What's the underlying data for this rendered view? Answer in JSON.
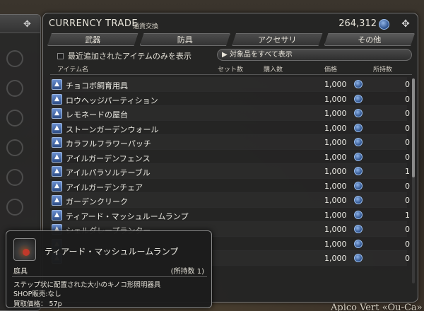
{
  "window": {
    "title": "CURRENCY TRADE",
    "subtitle": "通貨交換",
    "currency_amount": "264,312"
  },
  "tabs": [
    {
      "label": "武器"
    },
    {
      "label": "防具"
    },
    {
      "label": "アクセサリ"
    },
    {
      "label": "その他"
    }
  ],
  "filter": {
    "recent_only_label": "最近追加されたアイテムのみを表示",
    "show_all_label": "▶ 対象品をすべて表示"
  },
  "columns": {
    "item": "アイテム名",
    "set": "セット数",
    "buy": "購入数",
    "price": "価格",
    "owned": "所持数"
  },
  "items": [
    {
      "name": "チョコボ飼育用具",
      "price": "1,000",
      "owned": "0"
    },
    {
      "name": "ロウヘッジパーティション",
      "price": "1,000",
      "owned": "0"
    },
    {
      "name": "レモネードの屋台",
      "price": "1,000",
      "owned": "0"
    },
    {
      "name": "ストーンガーデンウォール",
      "price": "1,000",
      "owned": "0"
    },
    {
      "name": "カラフルフラワーパッチ",
      "price": "1,000",
      "owned": "0"
    },
    {
      "name": "アイルガーデンフェンス",
      "price": "1,000",
      "owned": "0"
    },
    {
      "name": "アイルパラソルテーブル",
      "price": "1,000",
      "owned": "1"
    },
    {
      "name": "アイルガーデンチェア",
      "price": "1,000",
      "owned": "0"
    },
    {
      "name": "ガーデンクリーク",
      "price": "1,000",
      "owned": "0"
    },
    {
      "name": "ティアード・マッシュルームランプ",
      "price": "1,000",
      "owned": "1"
    },
    {
      "name": "シェルダレープランター",
      "price": "1,000",
      "owned": "0"
    },
    {
      "name": "",
      "price": "1,000",
      "owned": "0"
    },
    {
      "name": "",
      "price": "1,000",
      "owned": "0"
    }
  ],
  "tooltip": {
    "name": "ティアード・マッシュルームランプ",
    "category": "庭具",
    "owned": "(所持数 1)",
    "description": "ステップ状に配置された大小のキノコ形照明器具",
    "shop": "SHOP販売:なし",
    "sell_price": "買取価格： 57p"
  },
  "background": {
    "caption": "Apico Vert «Ou-Ca»"
  }
}
